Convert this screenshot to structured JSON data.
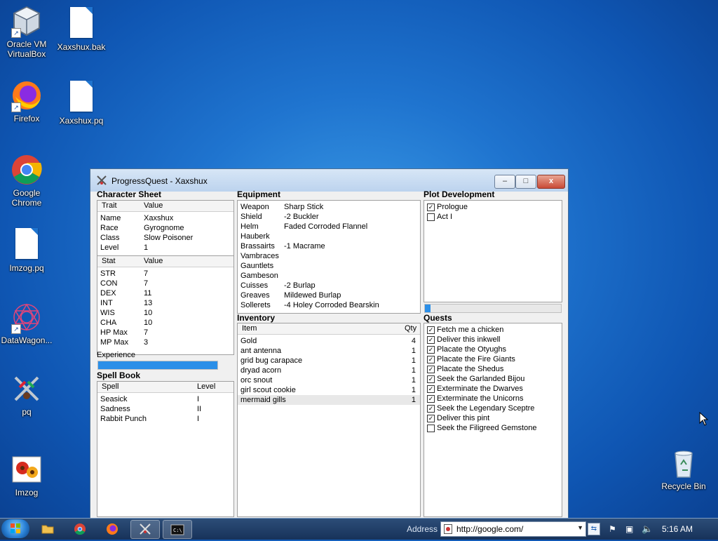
{
  "desktop_icons": [
    {
      "label": "Oracle VM VirtualBox"
    },
    {
      "label": "Xaxshux.bak"
    },
    {
      "label": "Firefox"
    },
    {
      "label": "Xaxshux.pq"
    },
    {
      "label": "Google Chrome"
    },
    {
      "label": "Imzog.pq"
    },
    {
      "label": "DataWagon..."
    },
    {
      "label": "pq"
    },
    {
      "label": "Imzog"
    },
    {
      "label": "Recycle Bin"
    }
  ],
  "window": {
    "title": "ProgressQuest - Xaxshux",
    "minimize": "–",
    "maximize": "□",
    "close": "x"
  },
  "character_sheet": {
    "title": "Character Sheet",
    "trait_header": [
      "Trait",
      "Value"
    ],
    "traits": [
      {
        "k": "Name",
        "v": "Xaxshux"
      },
      {
        "k": "Race",
        "v": "Gyrognome"
      },
      {
        "k": "Class",
        "v": "Slow Poisoner"
      },
      {
        "k": "Level",
        "v": "1"
      }
    ],
    "stat_header": [
      "Stat",
      "Value"
    ],
    "stats": [
      {
        "k": "STR",
        "v": "7"
      },
      {
        "k": "CON",
        "v": "7"
      },
      {
        "k": "DEX",
        "v": "11"
      },
      {
        "k": "INT",
        "v": "13"
      },
      {
        "k": "WIS",
        "v": "10"
      },
      {
        "k": "CHA",
        "v": "10"
      },
      {
        "k": "HP Max",
        "v": "7"
      },
      {
        "k": "MP Max",
        "v": "3"
      }
    ],
    "experience_label": "Experience",
    "experience_progress": 1.0
  },
  "spell_book": {
    "title": "Spell Book",
    "header": [
      "Spell",
      "Level"
    ],
    "spells": [
      {
        "k": "Seasick",
        "v": "I"
      },
      {
        "k": "Sadness",
        "v": "II"
      },
      {
        "k": "Rabbit Punch",
        "v": "I"
      }
    ]
  },
  "equipment": {
    "title": "Equipment",
    "items": [
      {
        "k": "Weapon",
        "v": "Sharp Stick"
      },
      {
        "k": "Shield",
        "v": "-2 Buckler"
      },
      {
        "k": "Helm",
        "v": "Faded Corroded Flannel"
      },
      {
        "k": "Hauberk",
        "v": ""
      },
      {
        "k": "Brassairts",
        "v": "-1 Macrame"
      },
      {
        "k": "Vambraces",
        "v": ""
      },
      {
        "k": "Gauntlets",
        "v": ""
      },
      {
        "k": "Gambeson",
        "v": ""
      },
      {
        "k": "Cuisses",
        "v": "-2 Burlap"
      },
      {
        "k": "Greaves",
        "v": "Mildewed Burlap"
      },
      {
        "k": "Sollerets",
        "v": "-4 Holey Corroded Bearskin"
      }
    ]
  },
  "inventory": {
    "title": "Inventory",
    "header": [
      "Item",
      "Qty"
    ],
    "items": [
      {
        "k": "Gold",
        "v": "4"
      },
      {
        "k": "ant antenna",
        "v": "1"
      },
      {
        "k": "grid bug carapace",
        "v": "1"
      },
      {
        "k": "dryad acorn",
        "v": "1"
      },
      {
        "k": "orc snout",
        "v": "1"
      },
      {
        "k": "girl scout cookie",
        "v": "1"
      },
      {
        "k": "mermaid gills",
        "v": "1"
      }
    ]
  },
  "plot": {
    "title": "Plot Development",
    "acts": [
      {
        "label": "Prologue",
        "checked": true
      },
      {
        "label": "Act I",
        "checked": false
      }
    ],
    "progress": 0.04
  },
  "quests": {
    "title": "Quests",
    "items": [
      {
        "label": "Fetch me a chicken",
        "checked": true
      },
      {
        "label": "Deliver this inkwell",
        "checked": true
      },
      {
        "label": "Placate the Otyughs",
        "checked": true
      },
      {
        "label": "Placate the Fire Giants",
        "checked": true
      },
      {
        "label": "Placate the Shedus",
        "checked": true
      },
      {
        "label": "Seek the Garlanded Bijou",
        "checked": true
      },
      {
        "label": "Exterminate the Dwarves",
        "checked": true
      },
      {
        "label": "Exterminate the Unicorns",
        "checked": true
      },
      {
        "label": "Seek the Legendary Sceptre",
        "checked": true
      },
      {
        "label": "Deliver this pint",
        "checked": true
      },
      {
        "label": "Seek the Filigreed Gemstone",
        "checked": false
      }
    ]
  },
  "taskbar": {
    "address_label": "Address",
    "address_value": "http://google.com/",
    "clock": "5:16 AM"
  }
}
